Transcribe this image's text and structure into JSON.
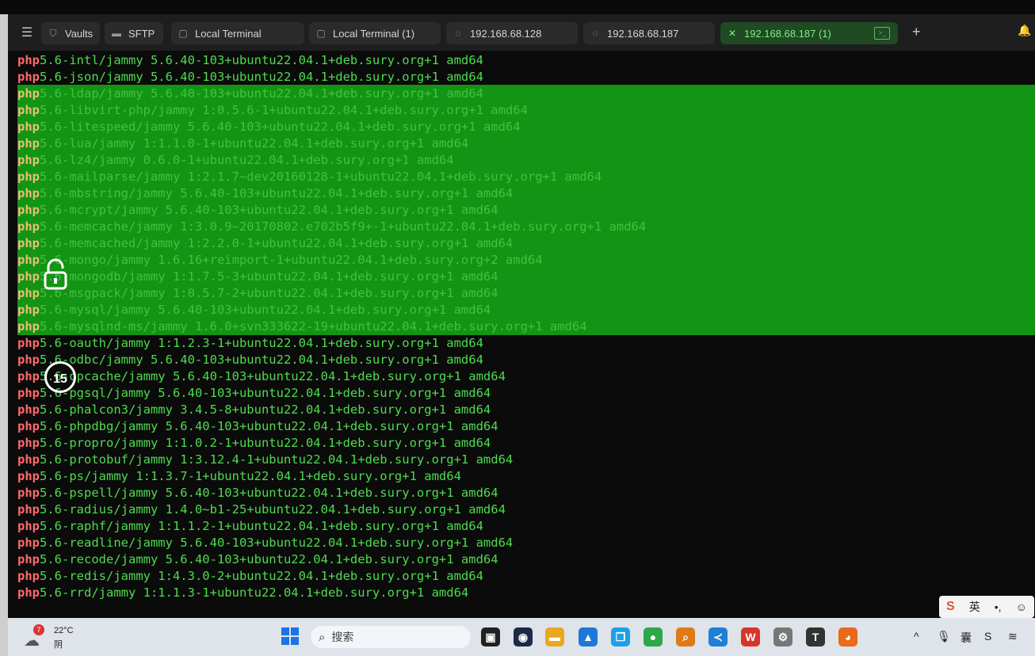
{
  "tabbar": {
    "tabs": [
      {
        "label": "Vaults",
        "icon": "vault-icon"
      },
      {
        "label": "SFTP",
        "icon": "folder-icon"
      },
      {
        "label": "Local Terminal",
        "icon": "terminal-icon"
      },
      {
        "label": "Local Terminal (1)",
        "icon": "terminal-icon"
      },
      {
        "label": "192.168.68.128",
        "icon": "host-icon"
      },
      {
        "label": "192.168.68.187",
        "icon": "host-icon"
      },
      {
        "label": "192.168.68.187 (1)",
        "icon": "close-icon",
        "active": true
      }
    ],
    "accent_color": "#7ef07e"
  },
  "terminal": {
    "lines": [
      {
        "kw": "php",
        "rest": "5.6-intl/jammy 5.6.40-103+ubuntu22.04.1+deb.sury.org+1 amd64"
      },
      {
        "kw": "php",
        "rest": "5.6-json/jammy 5.6.40-103+ubuntu22.04.1+deb.sury.org+1 amd64"
      },
      {
        "kw": "php",
        "rest": "5.6-ldap/jammy 5.6.40-103+ubuntu22.04.1+deb.sury.org+1 amd64",
        "sel": true
      },
      {
        "kw": "php",
        "rest": "5.6-libvirt-php/jammy 1:0.5.6-1+ubuntu22.04.1+deb.sury.org+1 amd64",
        "sel": true
      },
      {
        "kw": "php",
        "rest": "5.6-litespeed/jammy 5.6.40-103+ubuntu22.04.1+deb.sury.org+1 amd64",
        "sel": true
      },
      {
        "kw": "php",
        "rest": "5.6-lua/jammy 1:1.1.0-1+ubuntu22.04.1+deb.sury.org+1 amd64",
        "sel": true
      },
      {
        "kw": "php",
        "rest": "5.6-lz4/jammy 0.6.0-1+ubuntu22.04.1+deb.sury.org+1 amd64",
        "sel": true
      },
      {
        "kw": "php",
        "rest": "5.6-mailparse/jammy 1:2.1.7~dev20160128-1+ubuntu22.04.1+deb.sury.org+1 amd64",
        "sel": true
      },
      {
        "kw": "php",
        "rest": "5.6-mbstring/jammy 5.6.40-103+ubuntu22.04.1+deb.sury.org+1 amd64",
        "sel": true
      },
      {
        "kw": "php",
        "rest": "5.6-mcrypt/jammy 5.6.40-103+ubuntu22.04.1+deb.sury.org+1 amd64",
        "sel": true
      },
      {
        "kw": "php",
        "rest": "5.6-memcache/jammy 1:3.0.9~20170802.e702b5f9+-1+ubuntu22.04.1+deb.sury.org+1 amd64",
        "sel": true
      },
      {
        "kw": "php",
        "rest": "5.6-memcached/jammy 1:2.2.0-1+ubuntu22.04.1+deb.sury.org+1 amd64",
        "sel": true
      },
      {
        "kw": "php",
        "rest": "5.6-mongo/jammy 1.6.16+reimport-1+ubuntu22.04.1+deb.sury.org+2 amd64",
        "sel": true
      },
      {
        "kw": "php",
        "rest": "5.6-mongodb/jammy 1:1.7.5-3+ubuntu22.04.1+deb.sury.org+1 amd64",
        "sel": true
      },
      {
        "kw": "php",
        "rest": "5.6-msgpack/jammy 1:0.5.7-2+ubuntu22.04.1+deb.sury.org+1 amd64",
        "sel": true
      },
      {
        "kw": "php",
        "rest": "5.6-mysql/jammy 5.6.40-103+ubuntu22.04.1+deb.sury.org+1 amd64",
        "sel": true
      },
      {
        "kw": "php",
        "rest": "5.6-mysqlnd-ms/jammy 1.6.0+svn333622-19+ubuntu22.04.1+deb.sury.org+1 amd64",
        "sel": true
      },
      {
        "kw": "php",
        "rest": "5.6-oauth/jammy 1:1.2.3-1+ubuntu22.04.1+deb.sury.org+1 amd64"
      },
      {
        "kw": "php",
        "rest": "5.6-odbc/jammy 5.6.40-103+ubuntu22.04.1+deb.sury.org+1 amd64"
      },
      {
        "kw": "php",
        "rest": "5.6-opcache/jammy 5.6.40-103+ubuntu22.04.1+deb.sury.org+1 amd64"
      },
      {
        "kw": "php",
        "rest": "5.6-pgsql/jammy 5.6.40-103+ubuntu22.04.1+deb.sury.org+1 amd64"
      },
      {
        "kw": "php",
        "rest": "5.6-phalcon3/jammy 3.4.5-8+ubuntu22.04.1+deb.sury.org+1 amd64"
      },
      {
        "kw": "php",
        "rest": "5.6-phpdbg/jammy 5.6.40-103+ubuntu22.04.1+deb.sury.org+1 amd64"
      },
      {
        "kw": "php",
        "rest": "5.6-propro/jammy 1:1.0.2-1+ubuntu22.04.1+deb.sury.org+1 amd64"
      },
      {
        "kw": "php",
        "rest": "5.6-protobuf/jammy 1:3.12.4-1+ubuntu22.04.1+deb.sury.org+1 amd64"
      },
      {
        "kw": "php",
        "rest": "5.6-ps/jammy 1:1.3.7-1+ubuntu22.04.1+deb.sury.org+1 amd64"
      },
      {
        "kw": "php",
        "rest": "5.6-pspell/jammy 5.6.40-103+ubuntu22.04.1+deb.sury.org+1 amd64"
      },
      {
        "kw": "php",
        "rest": "5.6-radius/jammy 1.4.0~b1-25+ubuntu22.04.1+deb.sury.org+1 amd64"
      },
      {
        "kw": "php",
        "rest": "5.6-raphf/jammy 1:1.1.2-1+ubuntu22.04.1+deb.sury.org+1 amd64"
      },
      {
        "kw": "php",
        "rest": "5.6-readline/jammy 5.6.40-103+ubuntu22.04.1+deb.sury.org+1 amd64"
      },
      {
        "kw": "php",
        "rest": "5.6-recode/jammy 5.6.40-103+ubuntu22.04.1+deb.sury.org+1 amd64"
      },
      {
        "kw": "php",
        "rest": "5.6-redis/jammy 1:4.3.0-2+ubuntu22.04.1+deb.sury.org+1 amd64"
      },
      {
        "kw": "php",
        "rest": "5.6-rrd/jammy 1:1.1.3-1+ubuntu22.04.1+deb.sury.org+1 amd64"
      }
    ],
    "selection_color": "#149414",
    "keyword_color": "#ff6a6a",
    "text_color": "#4ddc4d",
    "replay_label": "15"
  },
  "ime": {
    "logo": "S",
    "lang": "英",
    "punct": "•,",
    "emoji": "☺"
  },
  "taskbar": {
    "weather": {
      "badge": "7",
      "temp": "22°C",
      "cond": "阴"
    },
    "search_placeholder": "搜索",
    "apps": [
      {
        "name": "task-view-icon",
        "glyph": "▣",
        "color": "#222"
      },
      {
        "name": "chat-app-icon",
        "glyph": "◉",
        "color": "#1b2a45"
      },
      {
        "name": "file-explorer-icon",
        "glyph": "▬",
        "color": "#e8a820"
      },
      {
        "name": "photos-icon",
        "glyph": "▲",
        "color": "#1e78d8"
      },
      {
        "name": "copy-app-icon",
        "glyph": "❐",
        "color": "#1ea0e8"
      },
      {
        "name": "chrome-icon",
        "glyph": "●",
        "color": "#2aa84a"
      },
      {
        "name": "search-app-icon",
        "glyph": "⌕",
        "color": "#e07a18"
      },
      {
        "name": "vscode-icon",
        "glyph": "≺",
        "color": "#1f7fd6"
      },
      {
        "name": "wps-icon",
        "glyph": "W",
        "color": "#d9342b"
      },
      {
        "name": "tool-icon",
        "glyph": "⚙",
        "color": "#777"
      },
      {
        "name": "typora-icon",
        "glyph": "T",
        "color": "#333"
      },
      {
        "name": "firefox-icon",
        "glyph": "◕",
        "color": "#e86a1a"
      }
    ],
    "tray": [
      {
        "name": "tray-chevron-icon",
        "glyph": "^"
      },
      {
        "name": "microphone-icon",
        "glyph": "🎙"
      },
      {
        "name": "ime-tray-icon",
        "glyph": "囊"
      },
      {
        "name": "sogou-tray-icon",
        "glyph": "S"
      },
      {
        "name": "wifi-icon",
        "glyph": "≋"
      }
    ]
  }
}
